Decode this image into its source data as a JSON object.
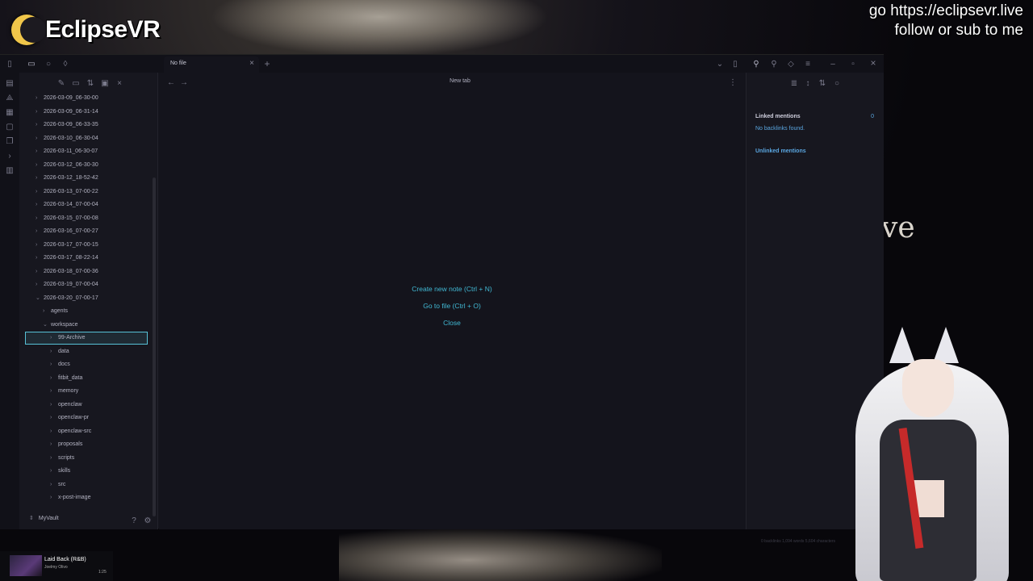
{
  "overlay": {
    "brand_name": "EclipseVR",
    "promo_line1": "go https://eclipsevr.live",
    "promo_line2": "follow or sub to me",
    "background_text": "ve"
  },
  "tabs": [
    {
      "label": "No file",
      "active": true
    }
  ],
  "header": {
    "title": "New tab"
  },
  "empty_state": {
    "create_note": "Create new note (Ctrl + N)",
    "go_to_file": "Go to file (Ctrl + O)",
    "close": "Close"
  },
  "sidebar": {
    "tree": [
      {
        "label": "2026-03-09_06-30-00",
        "depth": 0,
        "expanded": false
      },
      {
        "label": "2026-03-09_06-31-14",
        "depth": 0,
        "expanded": false
      },
      {
        "label": "2026-03-09_06-33-35",
        "depth": 0,
        "expanded": false
      },
      {
        "label": "2026-03-10_06-30-04",
        "depth": 0,
        "expanded": false
      },
      {
        "label": "2026-03-11_06-30-07",
        "depth": 0,
        "expanded": false
      },
      {
        "label": "2026-03-12_06-30-30",
        "depth": 0,
        "expanded": false
      },
      {
        "label": "2026-03-12_18-52-42",
        "depth": 0,
        "expanded": false
      },
      {
        "label": "2026-03-13_07-00-22",
        "depth": 0,
        "expanded": false
      },
      {
        "label": "2026-03-14_07-00-04",
        "depth": 0,
        "expanded": false
      },
      {
        "label": "2026-03-15_07-00-08",
        "depth": 0,
        "expanded": false
      },
      {
        "label": "2026-03-16_07-00-27",
        "depth": 0,
        "expanded": false
      },
      {
        "label": "2026-03-17_07-00-15",
        "depth": 0,
        "expanded": false
      },
      {
        "label": "2026-03-17_08-22-14",
        "depth": 0,
        "expanded": false
      },
      {
        "label": "2026-03-18_07-00-36",
        "depth": 0,
        "expanded": false
      },
      {
        "label": "2026-03-19_07-00-04",
        "depth": 0,
        "expanded": false
      },
      {
        "label": "2026-03-20_07-00-17",
        "depth": 0,
        "expanded": true
      },
      {
        "label": "agents",
        "depth": 1,
        "expanded": false
      },
      {
        "label": "workspace",
        "depth": 1,
        "expanded": true
      },
      {
        "label": "99-Archive",
        "depth": 2,
        "expanded": false,
        "selected": true
      },
      {
        "label": "data",
        "depth": 2,
        "expanded": false
      },
      {
        "label": "docs",
        "depth": 2,
        "expanded": false
      },
      {
        "label": "fitbit_data",
        "depth": 2,
        "expanded": false
      },
      {
        "label": "memory",
        "depth": 2,
        "expanded": false
      },
      {
        "label": "openclaw",
        "depth": 2,
        "expanded": false
      },
      {
        "label": "openclaw-pr",
        "depth": 2,
        "expanded": false
      },
      {
        "label": "openclaw-src",
        "depth": 2,
        "expanded": false
      },
      {
        "label": "proposals",
        "depth": 2,
        "expanded": false
      },
      {
        "label": "scripts",
        "depth": 2,
        "expanded": false
      },
      {
        "label": "skills",
        "depth": 2,
        "expanded": false
      },
      {
        "label": "src",
        "depth": 2,
        "expanded": false
      },
      {
        "label": "x-post-image",
        "depth": 2,
        "expanded": false
      }
    ],
    "vault_name": "MyVault"
  },
  "right_pane": {
    "linked_heading": "Linked mentions",
    "linked_count": "0",
    "no_backlinks": "No backlinks found.",
    "unlinked_heading": "Unlinked mentions",
    "status": "0 backlinks   1,094 words   5,604 characters"
  },
  "media": {
    "song": "Laid Back (R&B)",
    "artist": "Joelmy Olivo",
    "time": "1:25"
  },
  "icons": {
    "accent": "#41b8d3",
    "link": "#5aa6e0"
  }
}
